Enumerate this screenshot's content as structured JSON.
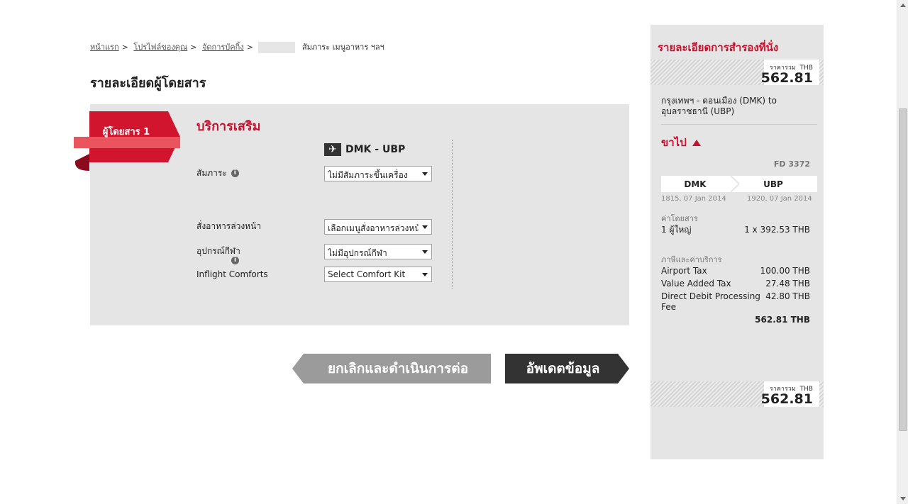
{
  "breadcrumb": {
    "home": "หน้าแรก",
    "profile": "โปรไฟล์ของคุณ",
    "manage": "จัดการบัคกิ้ง",
    "current": "สัมภาระ เมนูอาหาร ฯลฯ"
  },
  "page": {
    "title": "รายละเอียดผู้โดยสาร"
  },
  "passenger": {
    "ribbon_label": "ผู้โดยสาร 1"
  },
  "addons": {
    "section_title": "บริการเสริม",
    "route": "DMK - UBP",
    "plane_icon": "plane-icon",
    "baggage_label": "สัมภาระ",
    "baggage_value": "ไม่มีสัมภาระขึ้นเครื่อง",
    "meal_label": "สั่งอาหารล่วงหน้า",
    "meal_value": "เลือกเมนูสั่งอาหารล่วงหน้า",
    "sports_label": "อุปกรณ์กีฬา",
    "sports_value": "ไม่มีอุปกรณ์กีฬา",
    "comfort_label": "Inflight Comforts",
    "comfort_value": "Select Comfort Kit"
  },
  "buttons": {
    "cancel": "ยกเลิกและดำเนินการต่อ",
    "update": "อัพเดตข้อมูล"
  },
  "summary": {
    "title": "รายละเอียดการสำรองที่นั่ง",
    "total_caption": "ราคารวม",
    "currency": "THB",
    "total": "562.81",
    "route": "กรุงเทพฯ - ดอนเมือง (DMK) to อุบลราชธานี (UBP)",
    "outbound_label": "ขาไป",
    "flight_no": "FD 3372",
    "from_code": "DMK",
    "to_code": "UBP",
    "dep_time": "1815, 07 Jan 2014",
    "arr_time": "1920, 07 Jan 2014",
    "fare_label": "ค่าโดยสาร",
    "fare_pax": "1 ผู้ใหญ่",
    "fare_amount": "1 x 392.53 THB",
    "tax_label": "ภาษีและค่าบริการ",
    "airport_tax_label": "Airport Tax",
    "airport_tax": "100.00 THB",
    "vat_label": "Value Added Tax",
    "vat": "27.48 THB",
    "ddf_label": "Direct Debit Processing Fee",
    "ddf": "42.80 THB",
    "tax_total": "562.81 THB"
  },
  "colors": {
    "brand_red": "#c8102e",
    "panel_gray": "#e5e5e5",
    "dark_button": "#333333",
    "gray_button": "#9b9b9b"
  }
}
